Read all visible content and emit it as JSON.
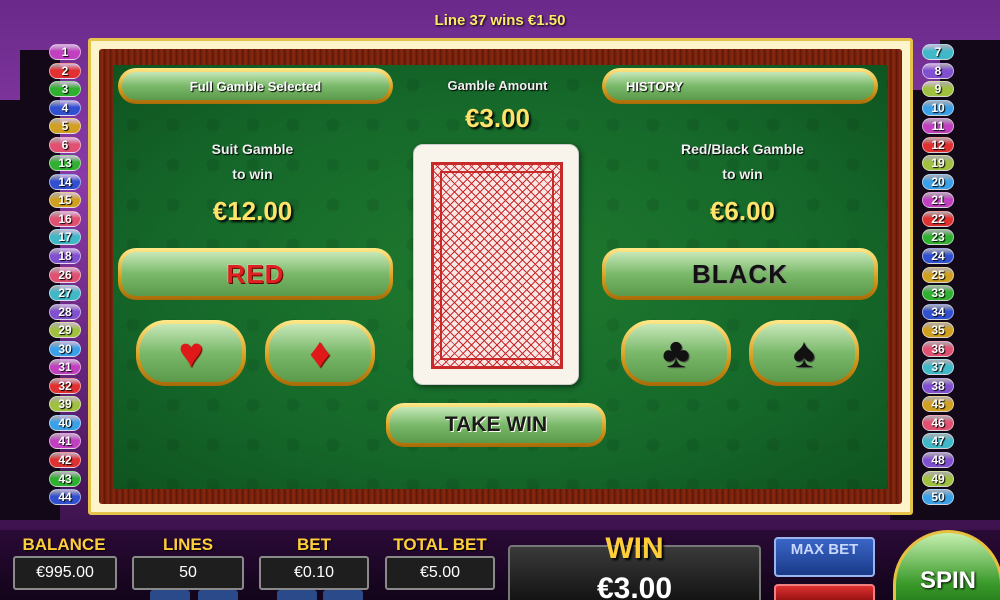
{
  "header": {
    "line_win_message": "Line 37 wins €1.50"
  },
  "paylines": {
    "left": [
      "1",
      "2",
      "3",
      "4",
      "5",
      "6",
      "13",
      "14",
      "15",
      "16",
      "17",
      "18",
      "26",
      "27",
      "28",
      "29",
      "30",
      "31",
      "32",
      "39",
      "40",
      "41",
      "42",
      "43",
      "44"
    ],
    "right": [
      "7",
      "8",
      "9",
      "10",
      "11",
      "12",
      "19",
      "20",
      "21",
      "22",
      "23",
      "24",
      "25",
      "33",
      "34",
      "35",
      "36",
      "37",
      "38",
      "45",
      "46",
      "47",
      "48",
      "49",
      "50"
    ]
  },
  "gamble": {
    "full_gamble_label": "Full Gamble Selected",
    "gamble_amount_label": "Gamble Amount",
    "gamble_amount": "€3.00",
    "history_label": "HISTORY",
    "suit": {
      "title_line1": "Suit Gamble",
      "title_line2": "to win",
      "amount": "€12.00"
    },
    "color": {
      "title_line1": "Red/Black Gamble",
      "title_line2": "to win",
      "amount": "€6.00"
    },
    "red_label": "RED",
    "black_label": "BLACK",
    "take_win_label": "TAKE WIN",
    "suits": {
      "hearts": "♥",
      "diamonds": "♦",
      "clubs": "♣",
      "spades": "♠"
    }
  },
  "bottom": {
    "balance_label": "BALANCE",
    "balance_value": "€995.00",
    "lines_label": "LINES",
    "lines_value": "50",
    "bet_label": "BET",
    "bet_value": "€0.10",
    "total_bet_label": "TOTAL BET",
    "total_bet_value": "€5.00",
    "win_label": "WIN",
    "win_value": "€3.00",
    "max_bet_label": "MAX BET",
    "spin_label": "SPIN"
  },
  "colors": {
    "gold": "#ffce3a",
    "felt": "#15682a",
    "red_suit": "#e01818",
    "black_suit": "#111111"
  }
}
